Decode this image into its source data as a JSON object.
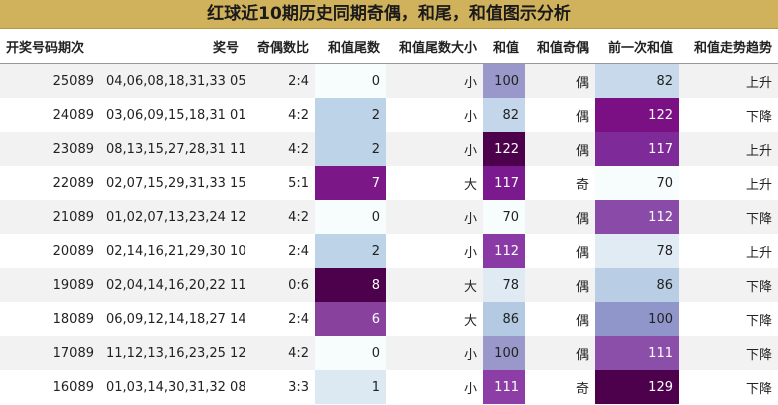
{
  "title": "红球近10期历史同期奇偶，和尾，和值图示分析",
  "chart_data": {
    "type": "table",
    "columns": [
      "开奖号码期次",
      "奖号",
      "奇偶数比",
      "和值尾数",
      "和值尾数大小",
      "和值",
      "和值奇偶",
      "前一次和值",
      "和值走势趋势"
    ],
    "rows": [
      {
        "issue": "25089",
        "numbers": "04,06,08,18,31,33 05",
        "ratio": "2:4",
        "tail": 0,
        "tail_size": "小",
        "sum": 100,
        "parity": "偶",
        "prev_sum": 82,
        "trend": "上升"
      },
      {
        "issue": "24089",
        "numbers": "03,06,09,15,18,31 01",
        "ratio": "4:2",
        "tail": 2,
        "tail_size": "小",
        "sum": 82,
        "parity": "偶",
        "prev_sum": 122,
        "trend": "下降"
      },
      {
        "issue": "23089",
        "numbers": "08,13,15,27,28,31 11",
        "ratio": "4:2",
        "tail": 2,
        "tail_size": "小",
        "sum": 122,
        "parity": "偶",
        "prev_sum": 117,
        "trend": "上升"
      },
      {
        "issue": "22089",
        "numbers": "02,07,15,29,31,33 15",
        "ratio": "5:1",
        "tail": 7,
        "tail_size": "大",
        "sum": 117,
        "parity": "奇",
        "prev_sum": 70,
        "trend": "上升"
      },
      {
        "issue": "21089",
        "numbers": "01,02,07,13,23,24 12",
        "ratio": "4:2",
        "tail": 0,
        "tail_size": "小",
        "sum": 70,
        "parity": "偶",
        "prev_sum": 112,
        "trend": "下降"
      },
      {
        "issue": "20089",
        "numbers": "02,14,16,21,29,30 10",
        "ratio": "2:4",
        "tail": 2,
        "tail_size": "小",
        "sum": 112,
        "parity": "偶",
        "prev_sum": 78,
        "trend": "上升"
      },
      {
        "issue": "19089",
        "numbers": "02,04,14,16,20,22 11",
        "ratio": "0:6",
        "tail": 8,
        "tail_size": "大",
        "sum": 78,
        "parity": "偶",
        "prev_sum": 86,
        "trend": "下降"
      },
      {
        "issue": "18089",
        "numbers": "06,09,12,14,18,27 14",
        "ratio": "2:4",
        "tail": 6,
        "tail_size": "大",
        "sum": 86,
        "parity": "偶",
        "prev_sum": 100,
        "trend": "下降"
      },
      {
        "issue": "17089",
        "numbers": "11,12,13,16,23,25 12",
        "ratio": "4:2",
        "tail": 0,
        "tail_size": "小",
        "sum": 100,
        "parity": "偶",
        "prev_sum": 111,
        "trend": "下降"
      },
      {
        "issue": "16089",
        "numbers": "01,03,14,30,31,32 08",
        "ratio": "3:3",
        "tail": 1,
        "tail_size": "小",
        "sum": 111,
        "parity": "奇",
        "prev_sum": 129,
        "trend": "下降"
      }
    ],
    "colormap": {
      "tail": [
        [
          0,
          "#f7fcfd"
        ],
        [
          1,
          "#dde9f2"
        ],
        [
          2,
          "#bdd3e7"
        ],
        [
          6,
          "#88419d"
        ],
        [
          7,
          "#7b1786"
        ],
        [
          8,
          "#4d004b"
        ]
      ],
      "sum": [
        [
          70,
          "#f7fcfd"
        ],
        [
          78,
          "#dfeaf3"
        ],
        [
          82,
          "#c3d6ea"
        ],
        [
          86,
          "#b4cae3"
        ],
        [
          100,
          "#9a98cb"
        ],
        [
          111,
          "#8c3ea6"
        ],
        [
          112,
          "#8a3aa4"
        ],
        [
          117,
          "#7a1a8e"
        ],
        [
          122,
          "#4d004b"
        ]
      ],
      "prev_sum": [
        [
          70,
          "#f7fcfd"
        ],
        [
          78,
          "#e1ebf4"
        ],
        [
          82,
          "#c9d9ec"
        ],
        [
          86,
          "#b9cde4"
        ],
        [
          100,
          "#9096c9"
        ],
        [
          111,
          "#8c4fa9"
        ],
        [
          112,
          "#8a4aa7"
        ],
        [
          117,
          "#7e2a98"
        ],
        [
          122,
          "#7a1084"
        ],
        [
          129,
          "#4d004b"
        ]
      ]
    }
  }
}
